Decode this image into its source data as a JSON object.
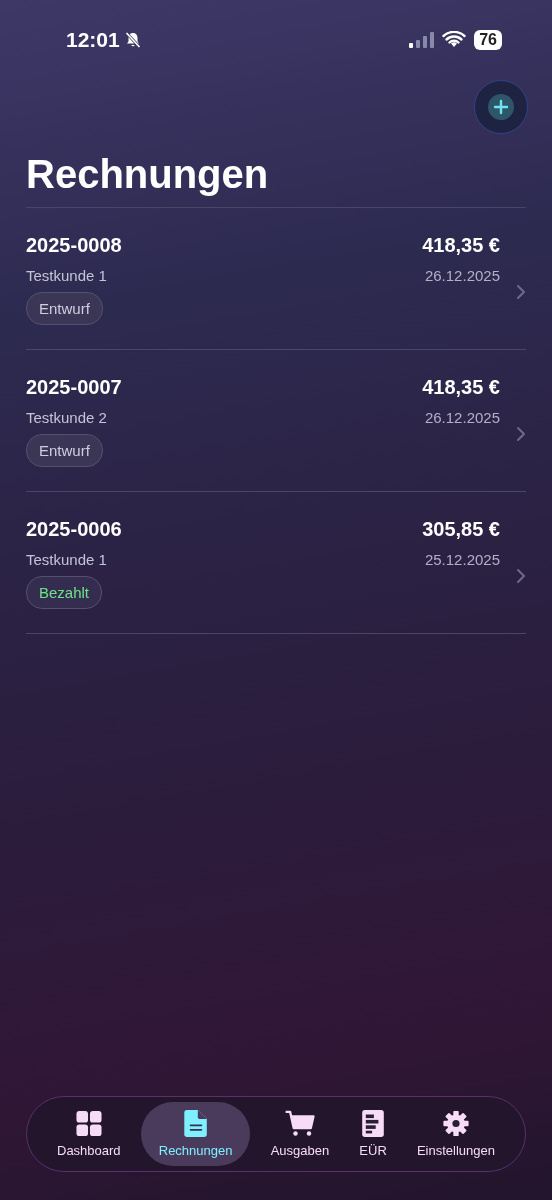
{
  "status_bar": {
    "time": "12:01",
    "battery": "76",
    "silent": true
  },
  "title": "Rechnungen",
  "invoices": [
    {
      "number": "2025-0008",
      "customer": "Testkunde 1",
      "amount": "418,35 €",
      "date": "26.12.2025",
      "status": {
        "label": "Entwurf",
        "kind": "draft"
      }
    },
    {
      "number": "2025-0007",
      "customer": "Testkunde 2",
      "amount": "418,35 €",
      "date": "26.12.2025",
      "status": {
        "label": "Entwurf",
        "kind": "draft"
      }
    },
    {
      "number": "2025-0006",
      "customer": "Testkunde 1",
      "amount": "305,85 €",
      "date": "25.12.2025",
      "status": {
        "label": "Bezahlt",
        "kind": "paid"
      }
    }
  ],
  "tab_bar": [
    {
      "label": "Dashboard",
      "kind": "grid",
      "selected": false
    },
    {
      "label": "Rechnungen",
      "kind": "document",
      "selected": true
    },
    {
      "label": "Ausgaben",
      "kind": "cart",
      "selected": false
    },
    {
      "label": "EÜR",
      "kind": "report",
      "selected": false
    },
    {
      "label": "Einstellungen",
      "kind": "gear",
      "selected": false
    }
  ]
}
